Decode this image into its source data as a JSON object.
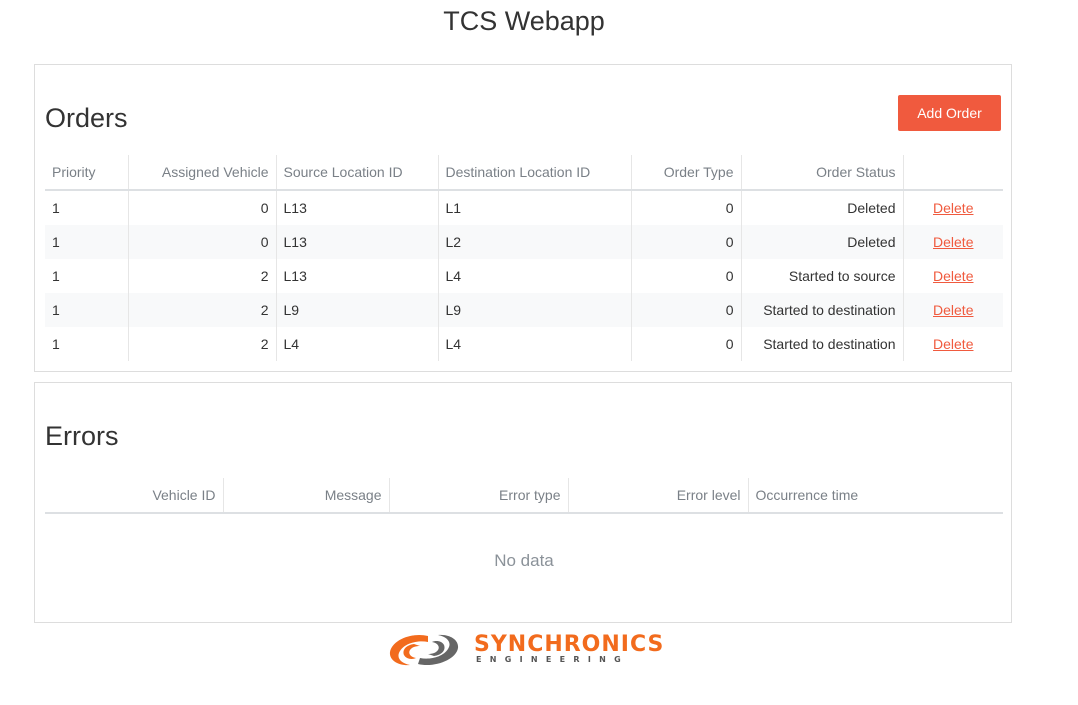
{
  "app": {
    "title": "TCS Webapp"
  },
  "orders": {
    "title": "Orders",
    "add_button_label": "Add Order",
    "columns": [
      "Priority",
      "Assigned Vehicle",
      "Source Location ID",
      "Destination Location ID",
      "Order Type",
      "Order Status",
      ""
    ],
    "rows": [
      {
        "priority": "1",
        "vehicle": "0",
        "source": "L13",
        "destination": "L1",
        "type": "0",
        "status": "Deleted",
        "action": "Delete"
      },
      {
        "priority": "1",
        "vehicle": "0",
        "source": "L13",
        "destination": "L2",
        "type": "0",
        "status": "Deleted",
        "action": "Delete"
      },
      {
        "priority": "1",
        "vehicle": "2",
        "source": "L13",
        "destination": "L4",
        "type": "0",
        "status": "Started to source",
        "action": "Delete"
      },
      {
        "priority": "1",
        "vehicle": "2",
        "source": "L9",
        "destination": "L9",
        "type": "0",
        "status": "Started to destination",
        "action": "Delete"
      },
      {
        "priority": "1",
        "vehicle": "2",
        "source": "L4",
        "destination": "L4",
        "type": "0",
        "status": "Started to destination",
        "action": "Delete"
      }
    ]
  },
  "errors": {
    "title": "Errors",
    "columns": [
      "Vehicle ID",
      "Message",
      "Error type",
      "Error level",
      "Occurrence time"
    ],
    "empty_text": "No data"
  },
  "footer": {
    "logo_text": "SYNCHRONICS",
    "logo_subtext": "ENGINEERING",
    "logo_icon": "synchronics-swirl-icon"
  },
  "colors": {
    "accent": "#f05a3e",
    "logo_orange": "#f26b1d",
    "logo_gray": "#555555"
  }
}
